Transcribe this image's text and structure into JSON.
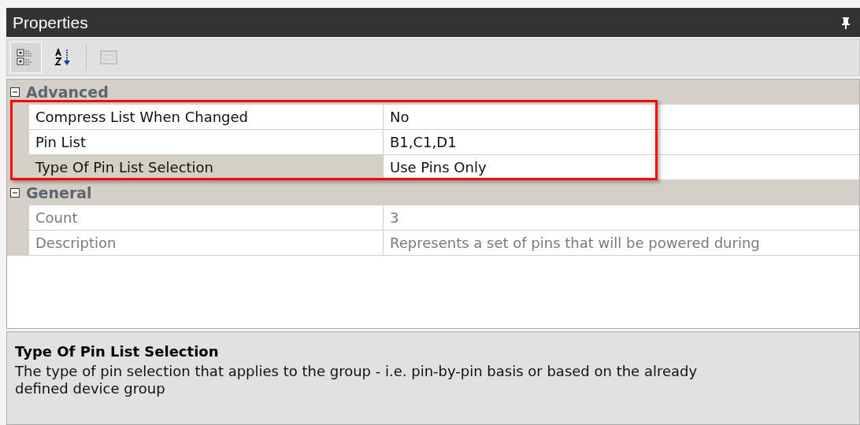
{
  "window": {
    "title": "Properties",
    "pinned": true
  },
  "toolbar": [
    {
      "kind": "categorized",
      "selected": true,
      "disabled": false
    },
    {
      "kind": "alphabetical",
      "selected": false,
      "disabled": false
    },
    {
      "kind": "property-pages",
      "selected": false,
      "disabled": true
    }
  ],
  "categories": [
    {
      "name": "Advanced",
      "expanded": true,
      "properties": [
        {
          "name": "Compress List When Changed",
          "value": "No",
          "readonly": false,
          "selected": false
        },
        {
          "name": "Pin List",
          "value": "B1,C1,D1",
          "readonly": false,
          "selected": false
        },
        {
          "name": "Type Of Pin List Selection",
          "value": "Use Pins Only",
          "readonly": false,
          "selected": true
        }
      ]
    },
    {
      "name": "General",
      "expanded": true,
      "properties": [
        {
          "name": "Count",
          "value": "3",
          "readonly": true,
          "selected": false
        },
        {
          "name": "Description",
          "value": "Represents a set of pins that will be powered during",
          "readonly": true,
          "selected": false
        }
      ]
    }
  ],
  "description": {
    "title": "Type Of Pin List Selection",
    "text": "The type of pin selection that applies to the group - i.e. pin-by-pin basis or based on the already defined device group"
  },
  "highlight": {
    "kind": "box"
  }
}
